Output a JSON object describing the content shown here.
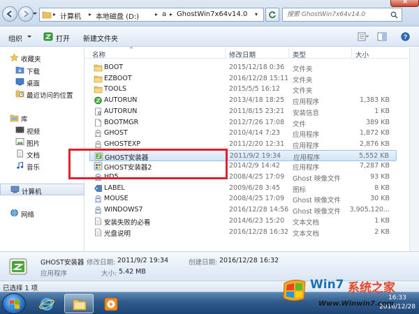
{
  "address": {
    "crumbs": [
      "计算机",
      "本地磁盘 (D:)",
      "a",
      "GhostWin7x64v14.0"
    ],
    "search_placeholder": "搜索 GhostWin7x64v14.0"
  },
  "toolbar": {
    "organize": "组织",
    "open": "打开",
    "new_folder": "新建文件夹"
  },
  "nav": {
    "favorites": "收藏夹",
    "favorites_items": [
      "下载",
      "桌面",
      "最近访问的位置"
    ],
    "libraries": "库",
    "libraries_items": [
      "视频",
      "图片",
      "文档",
      "音乐"
    ],
    "computer": "计算机",
    "network": "网络"
  },
  "columns": {
    "name": "名称",
    "date": "修改日期",
    "type": "类型",
    "size": "大小"
  },
  "files": [
    {
      "name": "BOOT",
      "date": "2015/12/18 0:36",
      "type": "文件夹",
      "size": "",
      "icon": "folder-icon"
    },
    {
      "name": "EZBOOT",
      "date": "2016/12/28 15:11",
      "type": "文件夹",
      "size": "",
      "icon": "folder-icon"
    },
    {
      "name": "TOOLS",
      "date": "2015/5/5 16:12",
      "type": "文件夹",
      "size": "",
      "icon": "folder-icon"
    },
    {
      "name": "AUTORUN",
      "date": "2013/4/18 18:25",
      "type": "应用程序",
      "size": "1,383 KB",
      "icon": "autorun-exe-icon"
    },
    {
      "name": "AUTORUN",
      "date": "2011/8/15 23:21",
      "type": "安装信息",
      "size": "1 KB",
      "icon": "setup-info-icon"
    },
    {
      "name": "BOOTMGR",
      "date": "2012/7/26 17:08",
      "type": "文件",
      "size": "389 KB",
      "icon": "file-icon"
    },
    {
      "name": "GHOST",
      "date": "2010/4/14 7:23",
      "type": "应用程序",
      "size": "1,872 KB",
      "icon": "ghost-exe-icon"
    },
    {
      "name": "GHOSTEXP",
      "date": "2011/2/20 12:31",
      "type": "应用程序",
      "size": "2,876 KB",
      "icon": "ghost-exe-icon"
    },
    {
      "name": "GHOST安装器",
      "date": "2011/9/2 19:34",
      "type": "应用程序",
      "size": "5,552 KB",
      "icon": "ghost-installer-icon"
    },
    {
      "name": "GHOST安装器2",
      "date": "2014/2/9 14:42",
      "type": "应用程序",
      "size": "7,287 KB",
      "icon": "ghost-installer2-icon"
    },
    {
      "name": "HD5",
      "date": "2008/4/25 17:09",
      "type": "Ghost 映像文件",
      "size": "93 KB",
      "icon": "ghost-image-icon"
    },
    {
      "name": "LABEL",
      "date": "2009/6/28 3:45",
      "type": "图标",
      "size": "8 KB",
      "icon": "label-icon"
    },
    {
      "name": "MOUSE",
      "date": "2008/4/25 17:09",
      "type": "Ghost 映像文件",
      "size": "30 KB",
      "icon": "ghost-image-icon"
    },
    {
      "name": "WINDOWS7",
      "date": "2016/12/28 14:56",
      "type": "Ghost 映像文件",
      "size": "3,905,120...",
      "icon": "ghost-image-icon"
    },
    {
      "name": "安装失败的必看",
      "date": "2014/6/23 15:20",
      "type": "文本文档",
      "size": "1 KB",
      "icon": "text-file-icon"
    },
    {
      "name": "光盘说明",
      "date": "2016/12/28 16:32",
      "type": "文本文档",
      "size": "2 KB",
      "icon": "text-file-icon"
    }
  ],
  "selected_index": 8,
  "details": {
    "name": "GHOST安装器",
    "modified_label": "修改日期:",
    "modified_value": "2011/9/2 19:34",
    "created_label": "创建日期:",
    "created_value": "2016/12/28 16:32",
    "type": "应用程序",
    "size_label": "大小:",
    "size_value": "5.42 MB"
  },
  "status": {
    "selected": "已选择 1 项"
  },
  "clock": {
    "time": "16:33",
    "date": "2016/12/28"
  },
  "watermark": {
    "brand_w": "Win7",
    "brand_cn": "系统之家",
    "url": "Www.Winwin7.com"
  },
  "colors": {
    "selection_border": "#9cc3ec",
    "highlight_box": "#e0202d",
    "taskbar": "#2f5b8c"
  }
}
